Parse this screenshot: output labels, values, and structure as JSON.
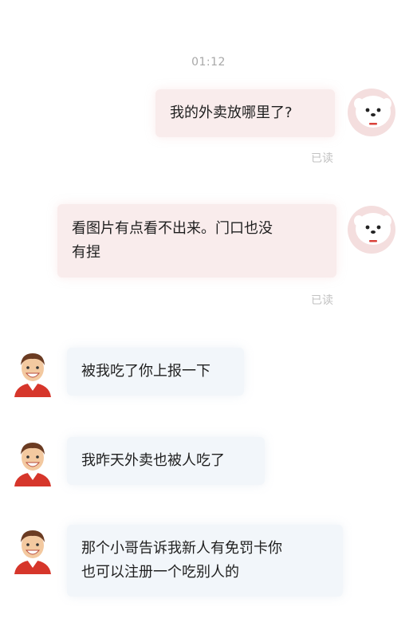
{
  "chat": {
    "timestamp": "01:12",
    "messages": [
      {
        "sender": "user",
        "avatar_icon": "jd-mascot-icon",
        "text": "我的外卖放哪里了?",
        "status": "已读"
      },
      {
        "sender": "user",
        "avatar_icon": "jd-mascot-icon",
        "lines": [
          "看图片有点看不出来。门口也没",
          "有捏"
        ],
        "status": "已读"
      },
      {
        "sender": "courier",
        "avatar_icon": "courier-avatar-icon",
        "text": "被我吃了你上报一下"
      },
      {
        "sender": "courier",
        "avatar_icon": "courier-avatar-icon",
        "text": "我昨天外卖也被人吃了"
      },
      {
        "sender": "courier",
        "avatar_icon": "courier-avatar-icon",
        "lines": [
          "那个小哥告诉我新人有免罚卡你",
          "也可以注册一个吃别人的"
        ]
      }
    ]
  },
  "colors": {
    "user_bubble": "#f9ecec",
    "courier_bubble": "#f2f6fa",
    "status_text": "#c2c2c2",
    "timestamp_text": "#a8a8a8",
    "mascot_mouth": "#d9423a",
    "courier_shirt": "#d6362b"
  }
}
